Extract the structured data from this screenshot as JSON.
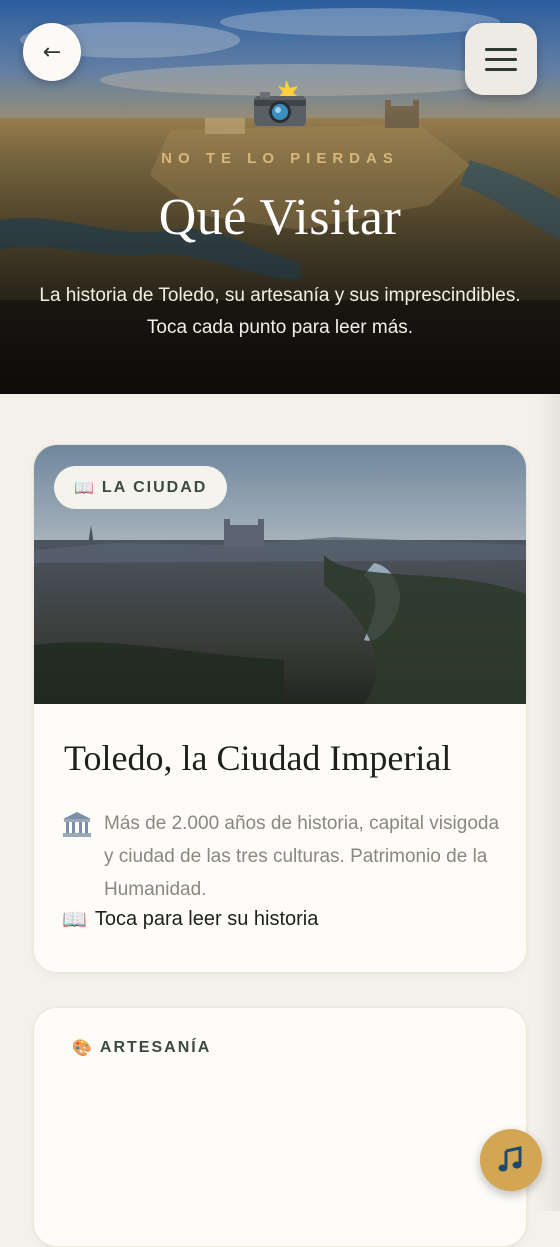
{
  "header": {
    "back_icon": "arrow-left-icon",
    "back_glyph": "←",
    "menu_icon": "hamburger-menu-icon",
    "camera_icon": "camera-flash-icon",
    "kicker": "NO TE LO PIERDAS",
    "title": "Qué Visitar",
    "subtitle_line1": "La historia de Toledo, su artesanía y sus imprescindibles.",
    "subtitle_line2": "Toca cada punto para leer más."
  },
  "cards": [
    {
      "chip_icon": "open-book-icon",
      "chip_glyph": "📖",
      "chip_label": "LA CIUDAD",
      "title": "Toledo, la Ciudad Imperial",
      "desc_icon": "classical-building-icon",
      "description": "Más de 2.000 años de historia, capital visigoda y ciudad de las tres culturas. Patrimonio de la Humanidad.",
      "link_icon": "open-book-icon",
      "link_glyph": "📖",
      "link_label": "Toca para leer su historia"
    },
    {
      "chip_icon": "artist-palette-icon",
      "chip_glyph": "🎨",
      "chip_label": "ARTESANÍA"
    }
  ],
  "music_icon": "music-note-icon",
  "colors": {
    "accent_gold": "#d2a653",
    "kicker_gold": "#d9b77a",
    "background": "#f4f1ea",
    "chip_text": "#3c4a3e"
  }
}
